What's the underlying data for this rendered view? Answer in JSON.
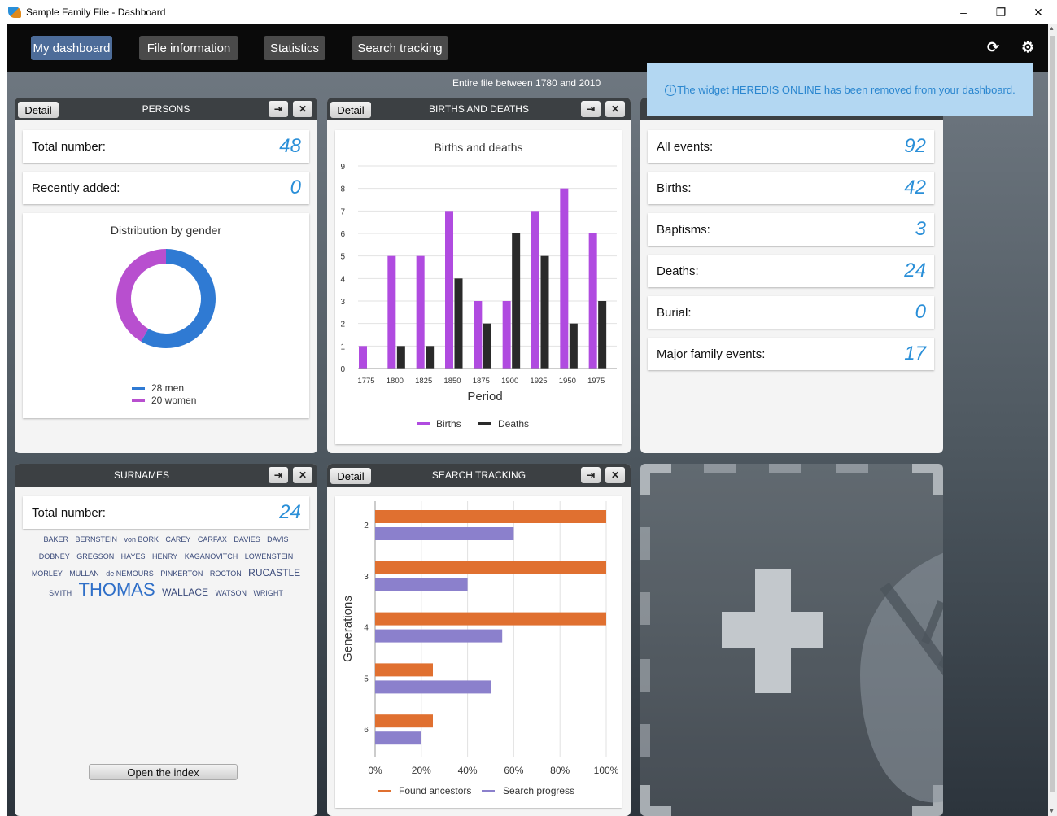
{
  "window": {
    "title": "Sample Family File - Dashboard",
    "controls": [
      "–",
      "❐",
      "✕"
    ]
  },
  "toolbar": {
    "tabs": [
      {
        "label": "My dashboard",
        "active": true
      },
      {
        "label": "File information",
        "active": false
      },
      {
        "label": "Statistics",
        "active": false
      },
      {
        "label": "Search tracking",
        "active": false
      }
    ],
    "refresh_icon": "refresh-icon",
    "settings_icon": "gear-icon"
  },
  "subtitle": "Entire file between 1780 and 2010",
  "notification": {
    "icon": "info-icon",
    "text": "The widget HEREDIS ONLINE has been removed from your dashboard."
  },
  "detail_label": "Detail",
  "persons": {
    "title": "PERSONS",
    "total_label": "Total number:",
    "total_value": "48",
    "recent_label": "Recently added:",
    "recent_value": "0",
    "gender_title": "Distribution by gender",
    "men_label": "28 men",
    "women_label": "20 women",
    "men_count": 28,
    "women_count": 20,
    "men_color": "#2f7ad3",
    "women_color": "#b84fcf"
  },
  "births_deaths": {
    "title": "BIRTHS AND DEATHS",
    "chart_data": {
      "type": "bar",
      "title": "Births and deaths",
      "xlabel": "Period",
      "ylabel": "",
      "ylim": [
        0,
        9
      ],
      "yticks": [
        0,
        1,
        2,
        3,
        4,
        5,
        6,
        7,
        8,
        9
      ],
      "categories": [
        "1775",
        "1800",
        "1825",
        "1850",
        "1875",
        "1900",
        "1925",
        "1950",
        "1975"
      ],
      "series": [
        {
          "name": "Births",
          "color": "#b04be0",
          "values": [
            1,
            5,
            5,
            7,
            3,
            3,
            7,
            8,
            6
          ]
        },
        {
          "name": "Deaths",
          "color": "#2a2a2a",
          "values": [
            0,
            1,
            1,
            4,
            2,
            6,
            5,
            2,
            3
          ]
        }
      ],
      "legend": "bottom"
    }
  },
  "events": {
    "rows": [
      {
        "label": "All events:",
        "value": "92"
      },
      {
        "label": "Births:",
        "value": "42"
      },
      {
        "label": "Baptisms:",
        "value": "3"
      },
      {
        "label": "Deaths:",
        "value": "24"
      },
      {
        "label": "Burial:",
        "value": "0"
      },
      {
        "label": "Major family events:",
        "value": "17"
      }
    ]
  },
  "surnames": {
    "title": "SURNAMES",
    "total_label": "Total number:",
    "total_value": "24",
    "cloud": [
      {
        "name": "BAKER",
        "size": 9
      },
      {
        "name": "BERNSTEIN",
        "size": 9
      },
      {
        "name": "von BORK",
        "size": 9
      },
      {
        "name": "CAREY",
        "size": 9
      },
      {
        "name": "CARFAX",
        "size": 9
      },
      {
        "name": "DAVIES",
        "size": 9
      },
      {
        "name": "DAVIS",
        "size": 9
      },
      {
        "name": "DOBNEY",
        "size": 9
      },
      {
        "name": "GREGSON",
        "size": 9
      },
      {
        "name": "HAYES",
        "size": 9
      },
      {
        "name": "HENRY",
        "size": 9
      },
      {
        "name": "KAGANOVITCH",
        "size": 9
      },
      {
        "name": "LOWENSTEIN",
        "size": 9
      },
      {
        "name": "MORLEY",
        "size": 9
      },
      {
        "name": "MULLAN",
        "size": 9
      },
      {
        "name": "de NEMOURS",
        "size": 9
      },
      {
        "name": "PINKERTON",
        "size": 9
      },
      {
        "name": "ROCTON",
        "size": 9
      },
      {
        "name": "RUCASTLE",
        "size": 12
      },
      {
        "name": "SMITH",
        "size": 9
      },
      {
        "name": "THOMAS",
        "size": 22
      },
      {
        "name": "WALLACE",
        "size": 12
      },
      {
        "name": "WATSON",
        "size": 9
      },
      {
        "name": "WRIGHT",
        "size": 9
      }
    ],
    "index_label": "Open the index"
  },
  "search_tracking": {
    "title": "SEARCH TRACKING",
    "chart_data": {
      "type": "bar",
      "orientation": "horizontal",
      "xlabel": "",
      "ylabel": "Generations",
      "xlim": [
        0,
        100
      ],
      "xticks": [
        "0%",
        "20%",
        "40%",
        "60%",
        "80%",
        "100%"
      ],
      "categories": [
        "2",
        "3",
        "4",
        "5",
        "6"
      ],
      "series": [
        {
          "name": "Found ancestors",
          "color": "#e07030",
          "values": [
            100,
            100,
            100,
            25,
            25
          ]
        },
        {
          "name": "Search progress",
          "color": "#8b80cc",
          "values": [
            60,
            40,
            55,
            50,
            20
          ]
        }
      ],
      "legend": "bottom"
    }
  },
  "add_widget": {
    "icon": "add-widget-icon",
    "bg_icon": "leaf-icon"
  }
}
